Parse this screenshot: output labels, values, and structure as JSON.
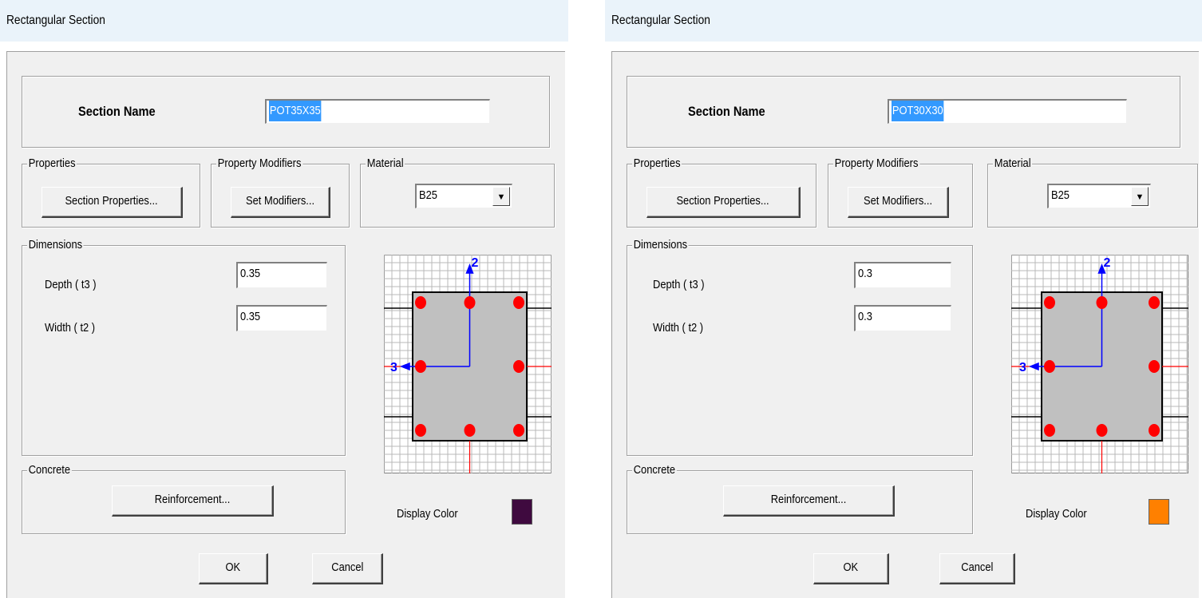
{
  "dialogs": [
    {
      "title": "Rectangular Section",
      "section_name_label": "Section Name",
      "section_name": "POT35X35",
      "properties_label": "Properties",
      "section_properties_button": "Section Properties...",
      "property_modifiers_label": "Property Modifiers",
      "set_modifiers_button": "Set Modifiers...",
      "material_label": "Material",
      "material_value": "B25",
      "dimensions_label": "Dimensions",
      "depth_label": "Depth  ( t3 )",
      "depth_value": "0.35",
      "width_label": "Width  ( t2 )",
      "width_value": "0.35",
      "concrete_label": "Concrete",
      "reinforcement_button": "Reinforcement...",
      "display_color_label": "Display Color",
      "display_color": "#3f0a3f",
      "ok_button": "OK",
      "cancel_button": "Cancel",
      "axis_2_label": "2",
      "axis_3_label": "3",
      "rebar_color": "#ff0000"
    },
    {
      "title": "Rectangular Section",
      "section_name_label": "Section Name",
      "section_name": "POT30X30",
      "properties_label": "Properties",
      "section_properties_button": "Section Properties...",
      "property_modifiers_label": "Property Modifiers",
      "set_modifiers_button": "Set Modifiers...",
      "material_label": "Material",
      "material_value": "B25",
      "dimensions_label": "Dimensions",
      "depth_label": "Depth  ( t3 )",
      "depth_value": "0.3",
      "width_label": "Width  ( t2 )",
      "width_value": "0.3",
      "concrete_label": "Concrete",
      "reinforcement_button": "Reinforcement...",
      "display_color_label": "Display Color",
      "display_color": "#ff8000",
      "ok_button": "OK",
      "cancel_button": "Cancel",
      "axis_2_label": "2",
      "axis_3_label": "3",
      "rebar_color": "#ff0000"
    }
  ]
}
